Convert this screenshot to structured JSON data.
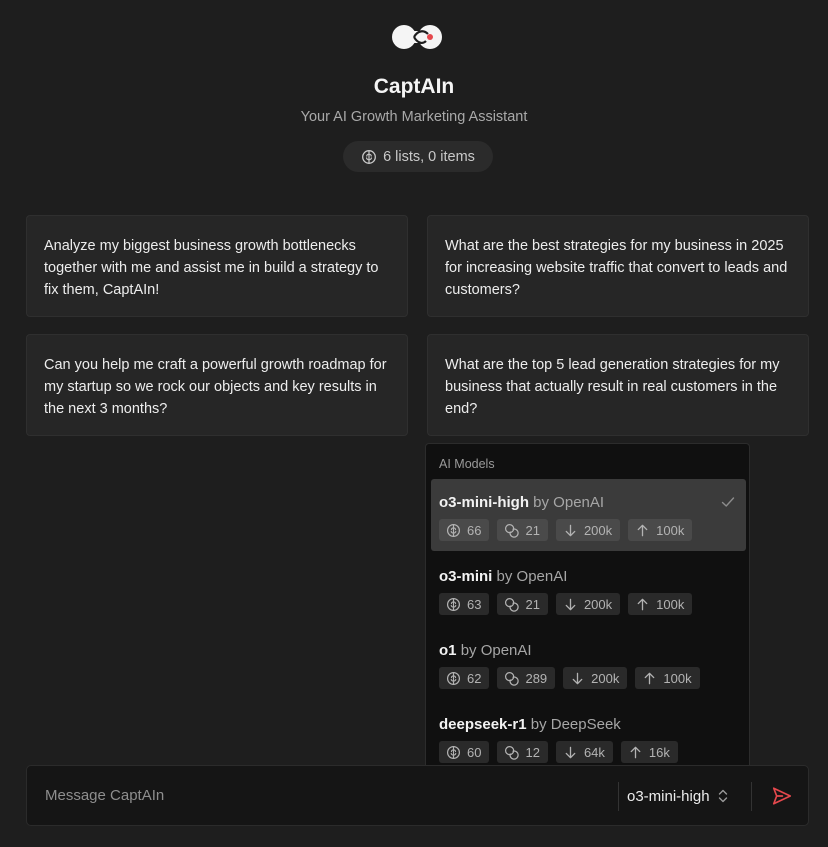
{
  "header": {
    "title": "CaptAIn",
    "subtitle": "Your AI Growth Marketing Assistant",
    "lists_badge": "6 lists, 0 items"
  },
  "suggestions": [
    "Analyze my biggest business growth bottlenecks together with me and assist me in build a strategy to fix them, CaptAIn!",
    "What are the best strategies for my business in 2025 for increasing website traffic that convert to leads and customers?",
    "Can you help me craft a powerful growth roadmap for my startup so we rock our objects and key results in the next 3 months?",
    "What are the top 5 lead generation strategies for my business that actually result in real customers in the end?"
  ],
  "models_menu": {
    "header": "AI Models",
    "items": [
      {
        "name": "o3-mini-high",
        "by": "by OpenAI",
        "intelligence": "66",
        "speed": "21",
        "input": "200k",
        "output": "100k",
        "selected": true
      },
      {
        "name": "o3-mini",
        "by": "by OpenAI",
        "intelligence": "63",
        "speed": "21",
        "input": "200k",
        "output": "100k",
        "selected": false
      },
      {
        "name": "o1",
        "by": "by OpenAI",
        "intelligence": "62",
        "speed": "289",
        "input": "200k",
        "output": "100k",
        "selected": false
      },
      {
        "name": "deepseek-r1",
        "by": "by DeepSeek",
        "intelligence": "60",
        "speed": "12",
        "input": "64k",
        "output": "16k",
        "selected": false
      }
    ]
  },
  "composer": {
    "placeholder": "Message CaptAIn",
    "selected_model": "o3-mini-high"
  },
  "colors": {
    "background": "#1e1e1e",
    "card": "#262626",
    "menu": "#101010",
    "selected_item": "#3b3b3b",
    "send_accent": "#e5484d"
  },
  "icons": {
    "logo": "infinity-logo-icon",
    "brain": "brain-icon",
    "coins": "coins-icon",
    "input": "arrow-down-icon",
    "output": "arrow-up-icon",
    "check": "check-icon",
    "chevrons": "chevron-up-down-icon",
    "send": "send-icon"
  }
}
